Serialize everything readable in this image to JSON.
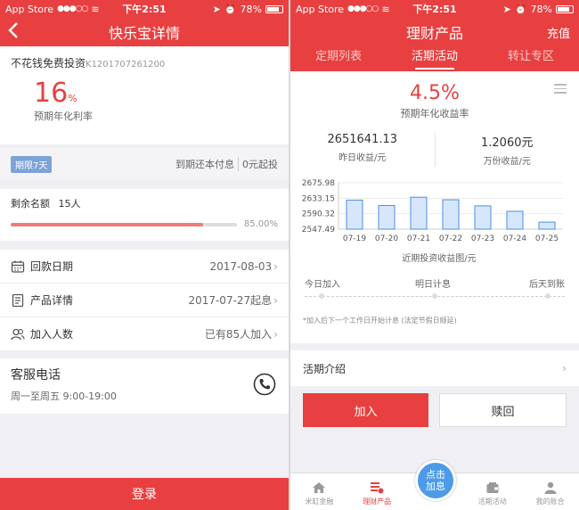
{
  "status_left": {
    "carrier": "App Store",
    "time": "下午2:51",
    "battery": "78%",
    "battery_level": 0.78
  },
  "status_right": {
    "carrier": "App Store",
    "time": "下午2:51",
    "battery": "78%",
    "battery_level": 0.78
  },
  "detail": {
    "nav_title": "快乐宝详情",
    "back_icon": "chevron-left-icon",
    "product_name": "不花钱免费投资",
    "product_code": "K1201707261200",
    "rate_value": "16",
    "rate_unit": "%",
    "rate_label": "预期年化利率",
    "term_tag": "期限7天",
    "repay_method": "到期还本付息",
    "min_invest": "0元起投",
    "quota_label": "剩余名额",
    "quota_value": "15人",
    "progress_text": "85.00%",
    "progress": 0.85,
    "rows": [
      {
        "icon": "calendar-icon",
        "label": "回款日期",
        "value": "2017-08-03"
      },
      {
        "icon": "document-icon",
        "label": "产品详情",
        "value": "2017-07-27起息"
      },
      {
        "icon": "users-icon",
        "label": "加入人数",
        "value": "已有85人加入"
      }
    ],
    "cs_title": "客服电话",
    "cs_hours": "周一至周五 9:00-19:00",
    "cs_icon": "phone-icon",
    "login_label": "登录"
  },
  "finance": {
    "nav_title": "理财产品",
    "recharge_label": "充值",
    "tabs": [
      "定期列表",
      "活期活动",
      "转让专区"
    ],
    "active_tab": 1,
    "rate": "4.5%",
    "rate_label": "预期年化收益率",
    "yesterday_value": "2651641.13",
    "yesterday_label": "昨日收益/元",
    "per10k_value": "1.2060元",
    "per10k_label": "万份收益/元",
    "chart_title": "近期投资收益图/元",
    "timeline": [
      "今日加入",
      "明日计息",
      "后天到账"
    ],
    "timeline_note": "*加入后下一个工作日开始计息 (法定节假日顺延)",
    "intro_label": "活期介绍",
    "join_label": "加入",
    "redeem_label": "赎回",
    "fab_label": "点击加息",
    "tabbar": [
      {
        "label": "米缸金融",
        "icon": "home-icon"
      },
      {
        "label": "理财产品",
        "icon": "finance-list-icon"
      },
      {
        "label": "",
        "icon": ""
      },
      {
        "label": "活期活动",
        "icon": "wallet-icon"
      },
      {
        "label": "我的账合",
        "icon": "user-icon"
      }
    ],
    "active_tabbar": 1
  },
  "chart_data": {
    "type": "bar",
    "categories": [
      "07-19",
      "07-20",
      "07-21",
      "07-22",
      "07-23",
      "07-24",
      "07-25"
    ],
    "values": [
      2628,
      2613,
      2636,
      2629,
      2612,
      2597,
      2567
    ],
    "y_ticks": [
      "2675.98",
      "2633.15",
      "2590.32",
      "2547.49"
    ],
    "ylim": [
      2547.49,
      2675.98
    ],
    "bar_fill": "#d7e7fb",
    "bar_stroke": "#4d8ee0",
    "grid": true,
    "title": "近期投资收益图/元"
  },
  "colors": {
    "brand_red": "#e84040",
    "accent_blue": "#4d9be8"
  }
}
